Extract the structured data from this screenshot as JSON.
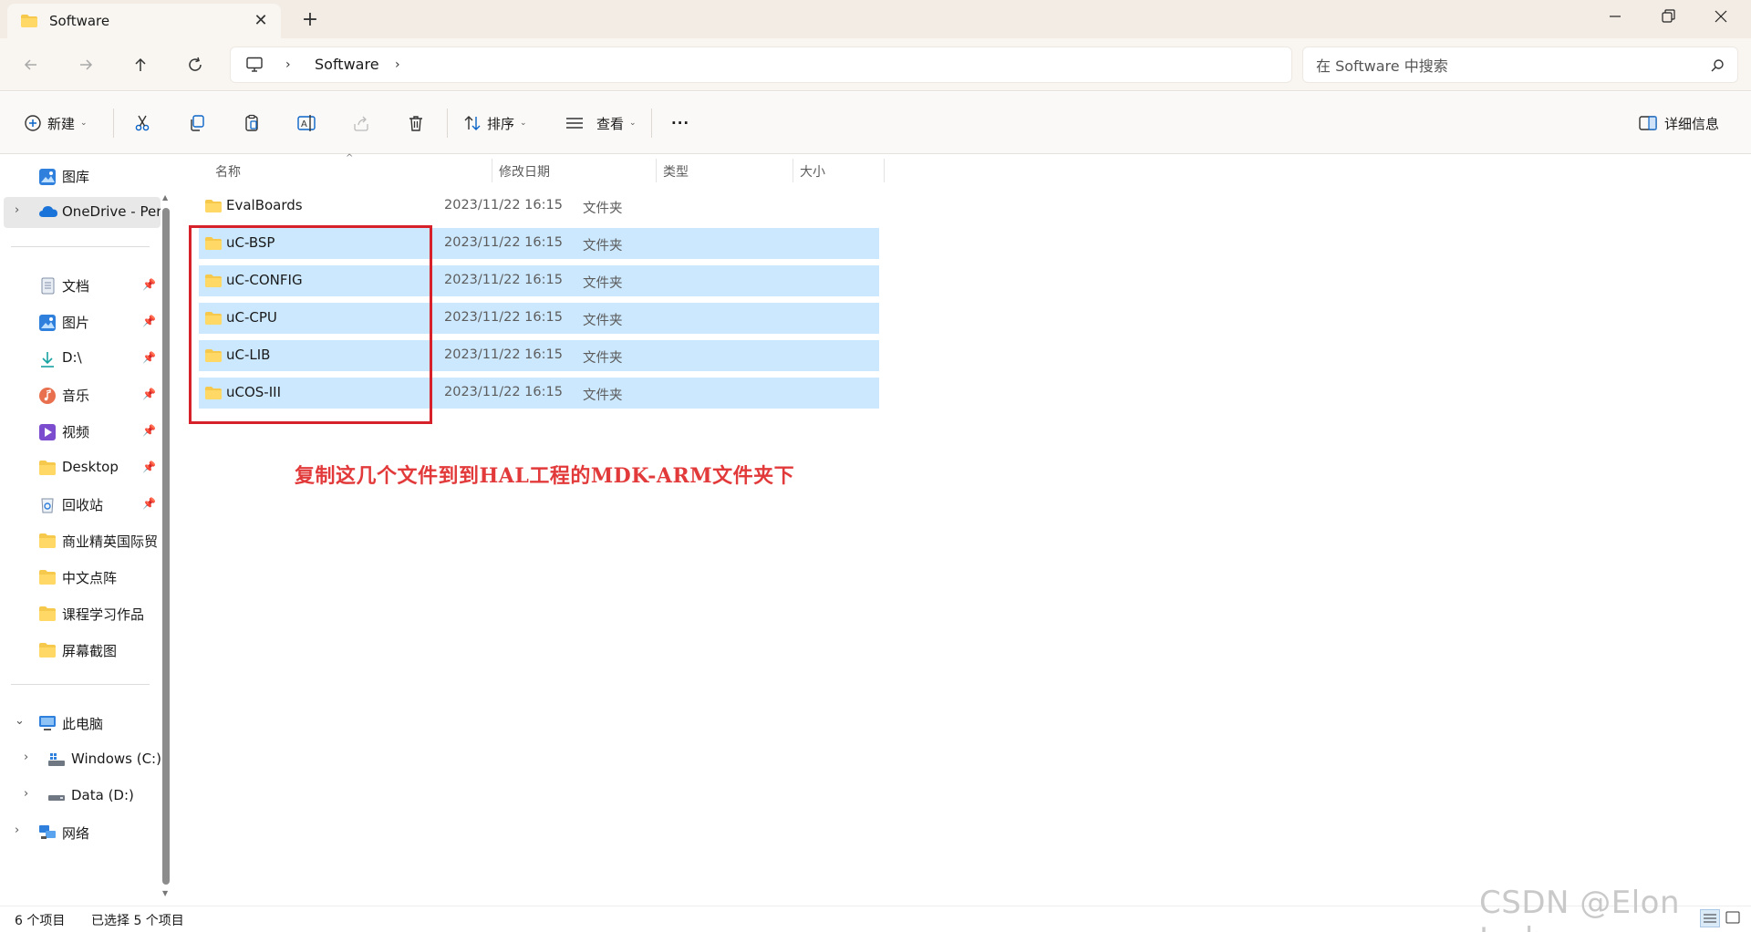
{
  "window": {
    "tab_title": "Software",
    "new_tab_glyph": "+",
    "close_glyph": "✕"
  },
  "nav": {
    "breadcrumb": [
      "Software"
    ],
    "search_placeholder": "在 Software 中搜索"
  },
  "toolbar": {
    "new_label": "新建",
    "sort_label": "排序",
    "view_label": "查看",
    "more_label": "···",
    "details_label": "详细信息"
  },
  "sidebar": {
    "top": [
      {
        "label": "图库",
        "icon": "gallery-icon"
      },
      {
        "label": "OneDrive - Per",
        "icon": "onedrive-icon"
      }
    ],
    "quick_access": [
      {
        "label": "文档",
        "icon": "documents-icon"
      },
      {
        "label": "图片",
        "icon": "pictures-icon"
      },
      {
        "label": "D:\\",
        "icon": "download-icon"
      },
      {
        "label": "音乐",
        "icon": "music-icon"
      },
      {
        "label": "视频",
        "icon": "video-icon"
      },
      {
        "label": "Desktop",
        "icon": "folder-icon"
      },
      {
        "label": "回收站",
        "icon": "recycle-bin-icon"
      },
      {
        "label": "商业精英国际贸",
        "icon": "folder-icon"
      },
      {
        "label": "中文点阵",
        "icon": "folder-icon"
      },
      {
        "label": "课程学习作品",
        "icon": "folder-icon"
      },
      {
        "label": "屏幕截图",
        "icon": "folder-icon"
      }
    ],
    "this_pc": {
      "label": "此电脑",
      "drives": [
        {
          "label": "Windows (C:)"
        },
        {
          "label": "Data (D:)"
        }
      ]
    },
    "network": {
      "label": "网络"
    }
  },
  "file_list": {
    "columns": [
      "名称",
      "修改日期",
      "类型",
      "大小"
    ],
    "rows": [
      {
        "name": "EvalBoards",
        "date": "2023/11/22 16:15",
        "type": "文件夹",
        "selected": false
      },
      {
        "name": "uC-BSP",
        "date": "2023/11/22 16:15",
        "type": "文件夹",
        "selected": true
      },
      {
        "name": "uC-CONFIG",
        "date": "2023/11/22 16:15",
        "type": "文件夹",
        "selected": true
      },
      {
        "name": "uC-CPU",
        "date": "2023/11/22 16:15",
        "type": "文件夹",
        "selected": true
      },
      {
        "name": "uC-LIB",
        "date": "2023/11/22 16:15",
        "type": "文件夹",
        "selected": true
      },
      {
        "name": "uCOS-III",
        "date": "2023/11/22 16:15",
        "type": "文件夹",
        "selected": true
      }
    ]
  },
  "annotation": {
    "text": "复制这几个文件到到HAL工程的MDK-ARM文件夹下",
    "color": "#e23a3a",
    "box_color": "#d6202a"
  },
  "status": {
    "item_count": "6 个项目",
    "selected_count": "已选择 5 个项目"
  },
  "watermark": "CSDN @Elon Josh",
  "colors": {
    "selection": "#cce8ff",
    "folder_yellow": "#f6c84c"
  }
}
